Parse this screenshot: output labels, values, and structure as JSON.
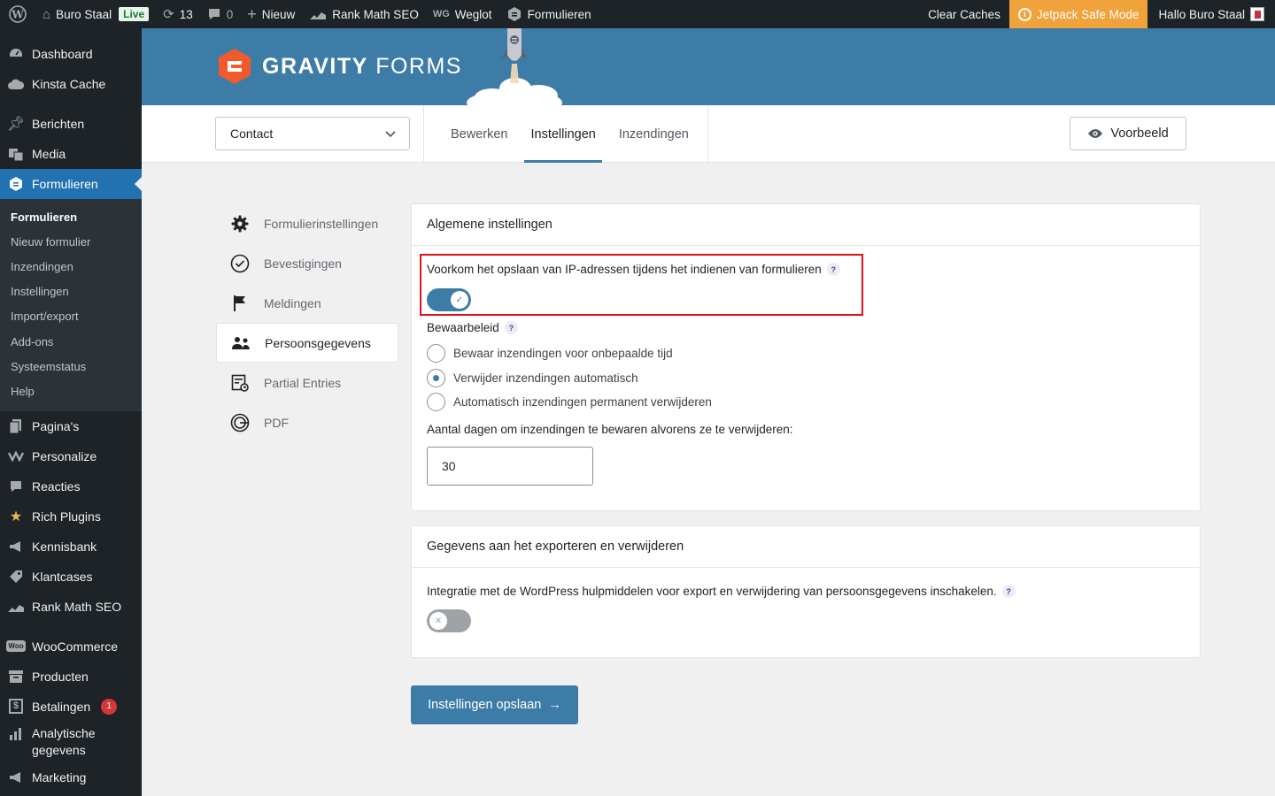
{
  "adminbar": {
    "site_name": "Buro Staal",
    "live_badge": "Live",
    "updates_count": "13",
    "comments_count": "0",
    "new_label": "Nieuw",
    "rankmath_label": "Rank Math SEO",
    "weglot_label": "Weglot",
    "weglot_icon_text": "WG",
    "forms_label": "Formulieren",
    "clear_caches": "Clear Caches",
    "jetpack_label": "Jetpack Safe Mode",
    "greeting": "Hallo Buro Staal"
  },
  "sidebar": {
    "items_top": [
      {
        "label": "Dashboard",
        "icon": "dashboard-icon"
      },
      {
        "label": "Kinsta Cache",
        "icon": "cloud-icon"
      }
    ],
    "items_content": [
      {
        "label": "Berichten",
        "icon": "pin-icon"
      },
      {
        "label": "Media",
        "icon": "media-icon"
      }
    ],
    "active_item": "Formulieren",
    "submenu": [
      "Formulieren",
      "Nieuw formulier",
      "Inzendingen",
      "Instellingen",
      "Import/export",
      "Add-ons",
      "Systeemstatus",
      "Help"
    ],
    "items_after": [
      {
        "label": "Pagina's",
        "icon": "page-icon"
      },
      {
        "label": "Personalize",
        "icon": "personalize-icon"
      },
      {
        "label": "Reacties",
        "icon": "comment-icon"
      },
      {
        "label": "Rich Plugins",
        "icon": "star-icon"
      },
      {
        "label": "Kennisbank",
        "icon": "megaphone-icon"
      },
      {
        "label": "Klantcases",
        "icon": "tag-icon"
      },
      {
        "label": "Rank Math SEO",
        "icon": "chart-icon"
      }
    ],
    "items_shop": [
      {
        "label": "WooCommerce",
        "icon": "woo-icon"
      },
      {
        "label": "Producten",
        "icon": "archive-icon"
      },
      {
        "label": "Betalingen",
        "icon": "dollar-icon",
        "badge": "1"
      },
      {
        "label": "Analytische gegevens",
        "icon": "bar-chart-icon"
      },
      {
        "label": "Marketing",
        "icon": "megaphone-icon"
      }
    ],
    "woo_icon_text": "Woo",
    "dollar_icon_text": "$"
  },
  "header": {
    "wordmark_bold": "GRAVITY",
    "wordmark_light": " FORMS"
  },
  "toolbar": {
    "form_name": "Contact",
    "tabs": [
      "Bewerken",
      "Instellingen",
      "Inzendingen"
    ],
    "active_tab": "Instellingen",
    "preview_label": "Voorbeeld"
  },
  "settings_nav": [
    {
      "label": "Formulierinstellingen",
      "icon": "gear-icon"
    },
    {
      "label": "Bevestigingen",
      "icon": "check-circle-icon"
    },
    {
      "label": "Meldingen",
      "icon": "flag-icon"
    },
    {
      "label": "Persoonsgegevens",
      "icon": "people-icon",
      "active": true
    },
    {
      "label": "Partial Entries",
      "icon": "partial-entries-icon"
    },
    {
      "label": "PDF",
      "icon": "pdf-icon"
    }
  ],
  "general": {
    "title": "Algemene instellingen",
    "ip_label": "Voorkom het opslaan van IP-adressen tijdens het indienen van formulieren",
    "ip_enabled": true,
    "retention_label": "Bewaarbeleid",
    "retention_options": [
      {
        "label": "Bewaar inzendingen voor onbepaalde tijd",
        "checked": false
      },
      {
        "label": "Verwijder inzendingen automatisch",
        "checked": true
      },
      {
        "label": "Automatisch inzendingen permanent verwijderen",
        "checked": false
      }
    ],
    "days_label": "Aantal dagen om inzendingen te bewaren alvorens ze te verwijderen:",
    "days_value": "30",
    "help_symbol": "?"
  },
  "export": {
    "title": "Gegevens aan het exporteren en verwijderen",
    "integration_label": "Integratie met de WordPress hulpmiddelen voor export en verwijdering van persoonsgegevens inschakelen.",
    "integration_enabled": false
  },
  "save_label": "Instellingen opslaan",
  "colors": {
    "accent": "#3e7ca8",
    "highlight": "#e3101c",
    "admin_bar": "#1d2327",
    "jetpack": "#f0a23b"
  }
}
